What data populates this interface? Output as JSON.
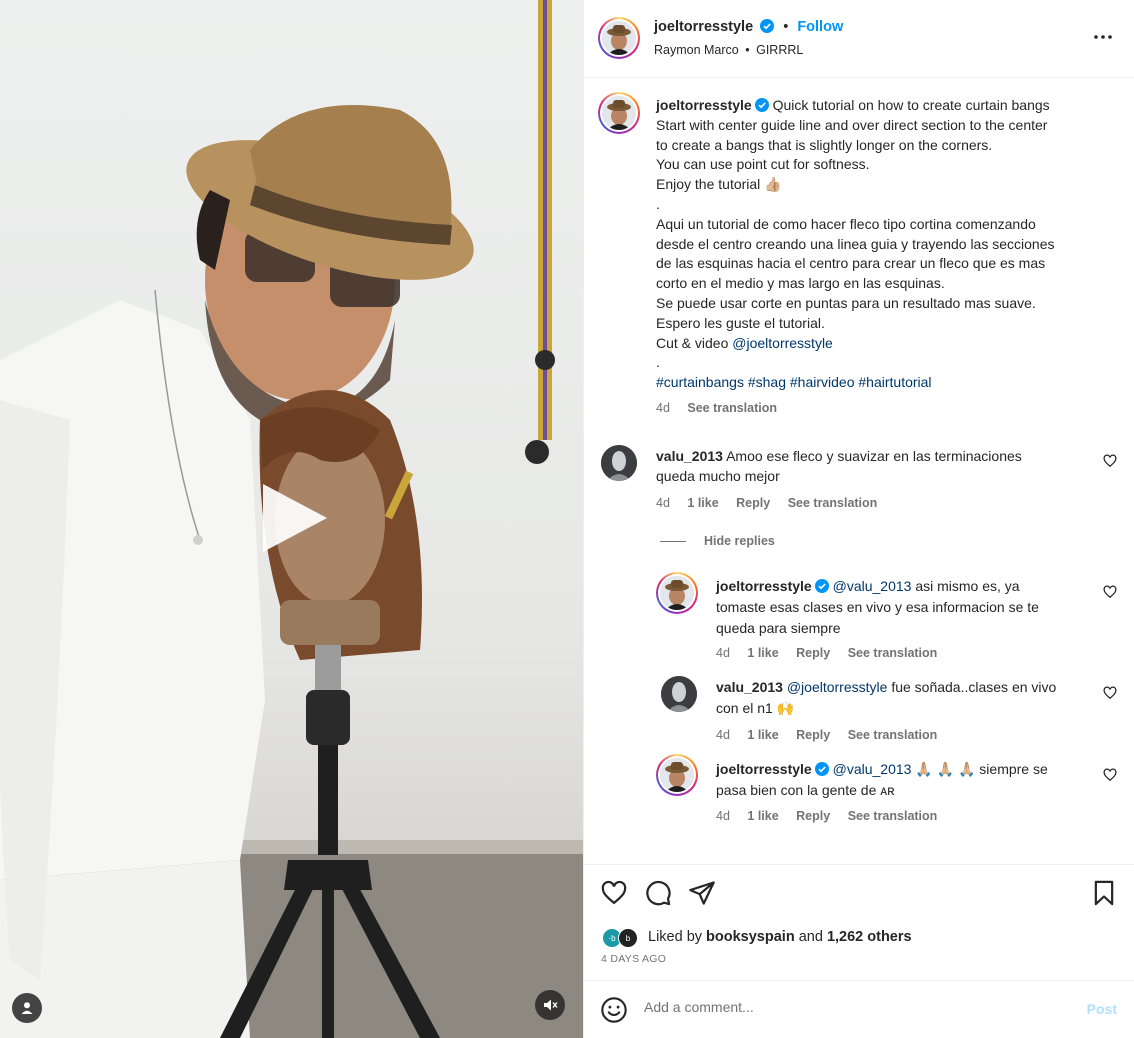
{
  "post": {
    "author": "joeltorresstyle",
    "follow_label": "Follow",
    "separator": "•",
    "audio_artist": "Raymon Marco",
    "audio_track": "GIRRRL",
    "caption_lines": [
      "Quick tutorial on how to create curtain bangs",
      "Start with center guide line and over direct section to the center",
      "to create a bangs that is slightly longer on the corners.",
      "You can use point cut for softness.",
      "Enjoy the tutorial 👍🏼",
      ".",
      "Aqui un tutorial de como hacer fleco tipo cortina comenzando",
      "desde el centro creando una linea guia y trayendo las secciones",
      "de las esquinas hacia el centro para crear un fleco que es mas",
      "corto en el medio y mas largo en las esquinas.",
      "Se puede usar corte en puntas para un resultado mas suave.",
      "Espero les guste el tutorial."
    ],
    "credit_prefix": "Cut & video",
    "credit_mention": "@joeltorresstyle",
    "dot_line": ".",
    "hashtags": [
      "#curtainbangs",
      "#shag",
      "#hairvideo",
      "#hairtutorial"
    ],
    "time": "4d",
    "see_translation": "See translation"
  },
  "comments": [
    {
      "user": "valu_2013",
      "text_line1": "Amoo ese fleco y suavizar en las terminaciones",
      "text_line2": "queda mucho mejor",
      "time": "4d",
      "likes": "1 like",
      "reply": "Reply",
      "translate": "See translation",
      "hide_replies": "Hide replies"
    }
  ],
  "replies": [
    {
      "user": "joeltorresstyle",
      "mention": "@valu_2013",
      "text_line1": "asi mismo es, ya",
      "text_line2": "tomaste esas clases en vivo y esa informacion se te",
      "text_line3": "queda para siempre",
      "time": "4d",
      "likes": "1 like",
      "reply": "Reply",
      "translate": "See translation"
    },
    {
      "user": "valu_2013",
      "mention": "@joeltorresstyle",
      "text_line1": "fue soñada..clases en vivo",
      "text_line2": "con el n1 🙌",
      "time": "4d",
      "likes": "1 like",
      "reply": "Reply",
      "translate": "See translation"
    },
    {
      "user": "joeltorresstyle",
      "mention": "@valu_2013",
      "text_line1": "🙏🏼 🙏🏼 🙏🏼 siempre se",
      "text_line2": "pasa bien con la gente de ᴀʀ",
      "time": "4d",
      "likes": "1 like",
      "reply": "Reply",
      "translate": "See translation"
    }
  ],
  "likes": {
    "prefix": "Liked by",
    "user": "booksyspain",
    "and": "and",
    "others": "1,262 others",
    "date": "4 DAYS AGO"
  },
  "add_comment": {
    "placeholder": "Add a comment...",
    "post_label": "Post"
  },
  "icons": {
    "more": "more-options-icon",
    "like": "heart-icon",
    "comment": "comment-icon",
    "share": "share-icon",
    "save": "bookmark-icon",
    "emoji": "emoji-icon",
    "play": "play-icon",
    "mute": "muted-speaker-icon",
    "tags": "user-tag-icon"
  },
  "colors": {
    "link": "#00376b",
    "accent": "#0095f6",
    "muted": "#737373"
  }
}
